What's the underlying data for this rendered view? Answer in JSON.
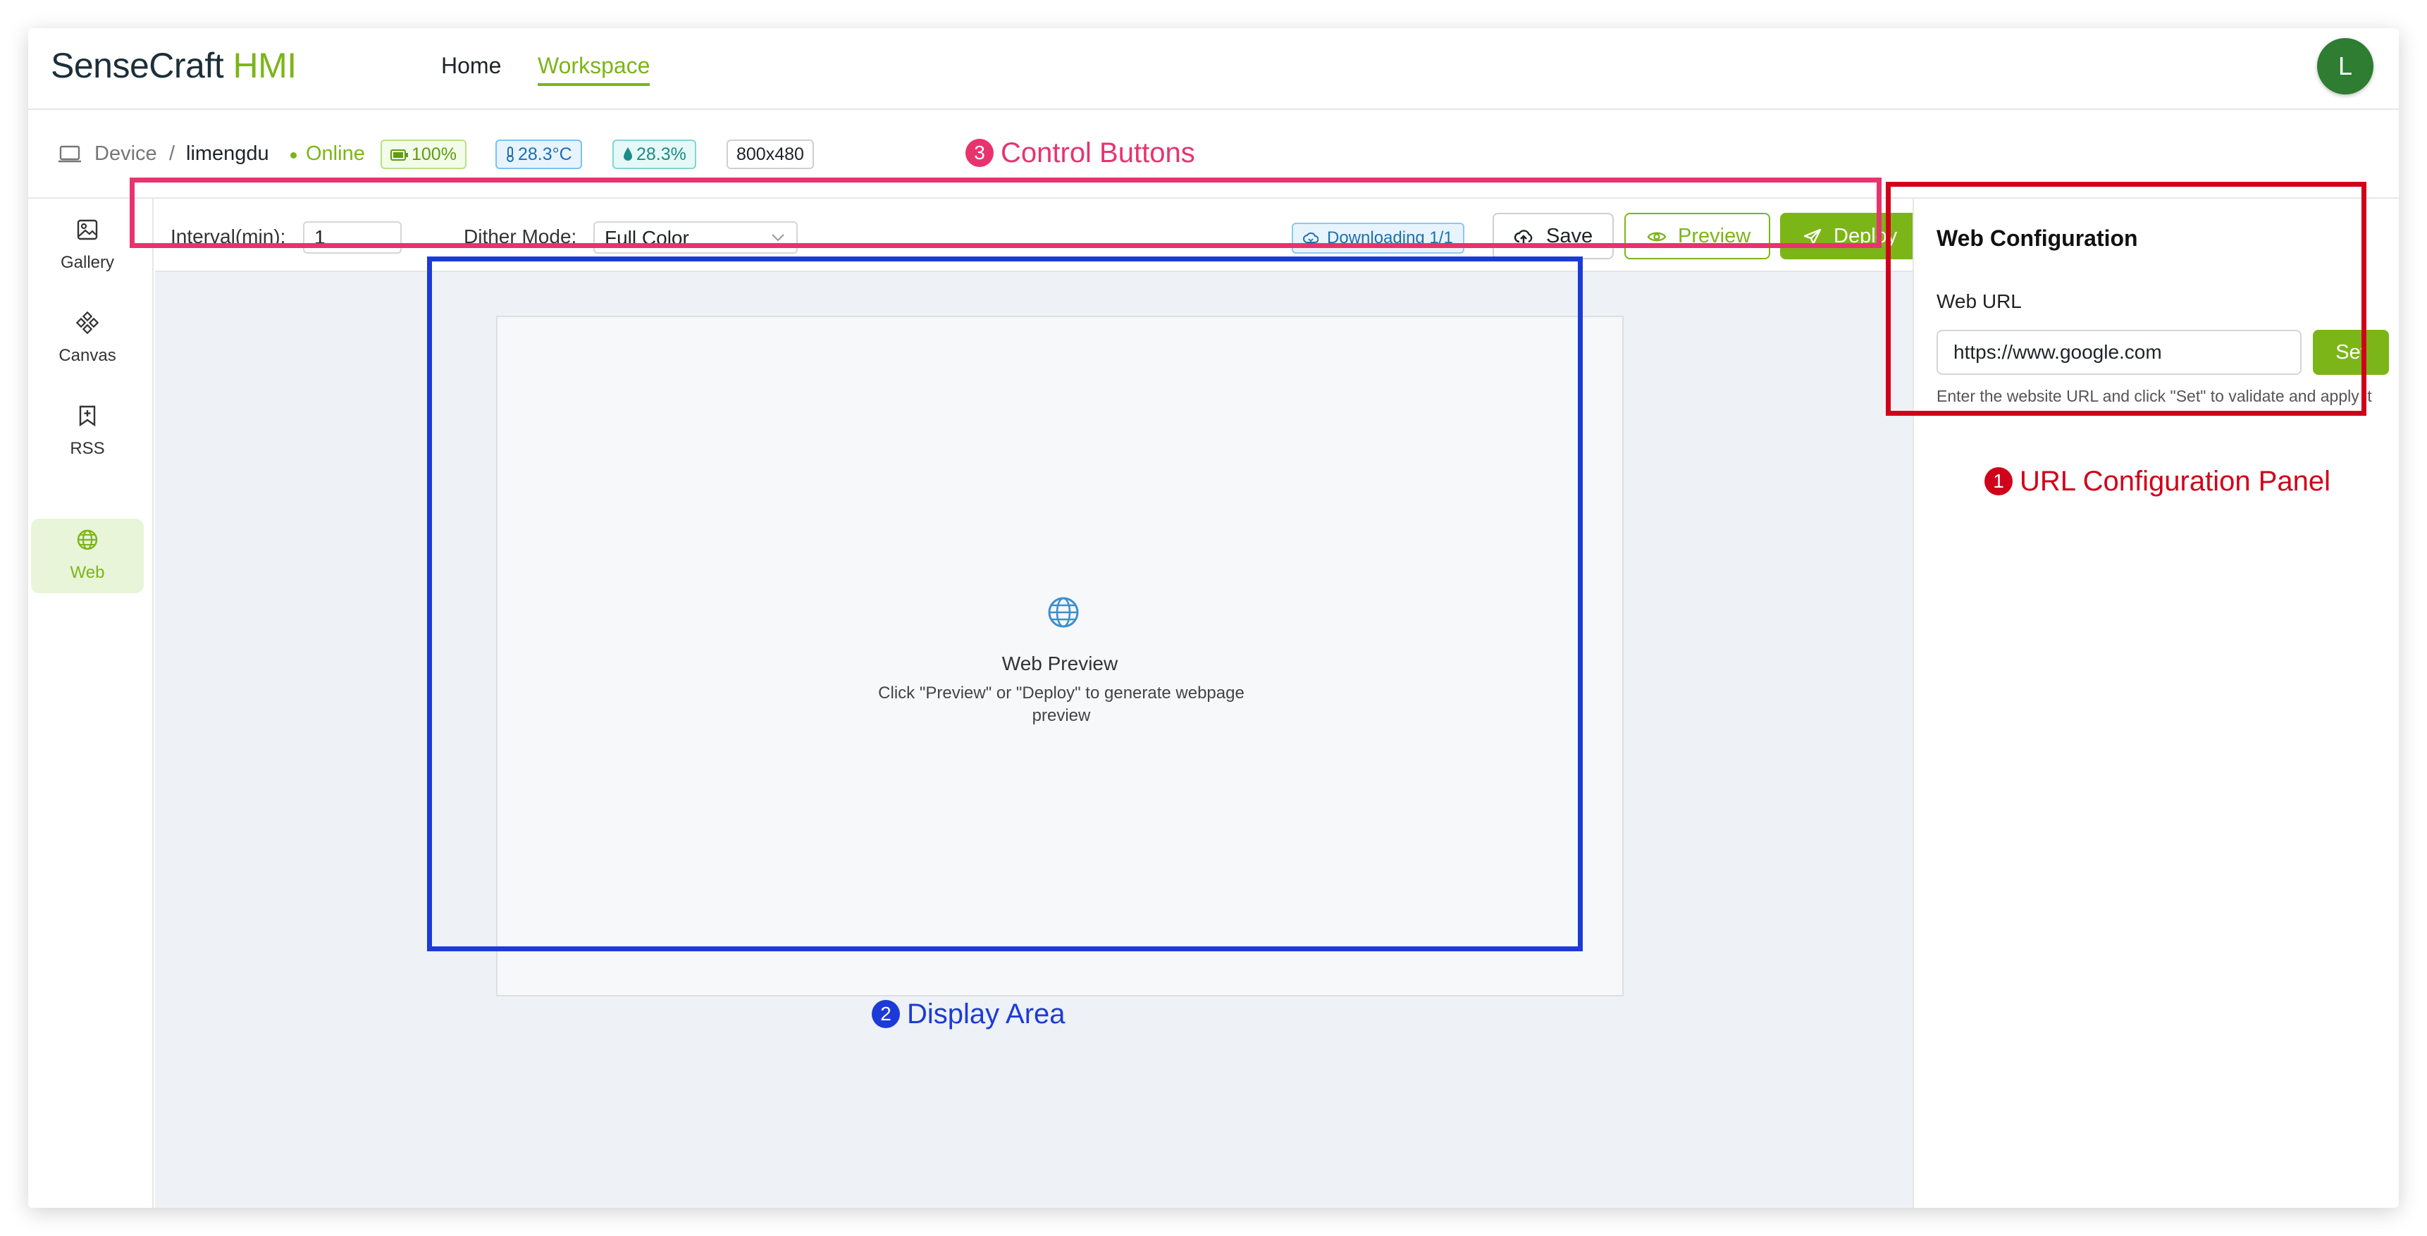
{
  "header": {
    "logo_dark": "SenseCraft",
    "logo_green": "HMI",
    "nav": [
      {
        "label": "Home",
        "active": false
      },
      {
        "label": "Workspace",
        "active": true
      }
    ],
    "avatar_initial": "L"
  },
  "device_bar": {
    "icon": "laptop-icon",
    "label": "Device",
    "separator": "/",
    "name": "limengdu",
    "status": "Online",
    "battery": "100%",
    "temperature": "28.3°C",
    "humidity": "28.3%",
    "resolution": "800x480"
  },
  "sidebar": {
    "items": [
      {
        "label": "Gallery",
        "icon": "image-icon",
        "active": false
      },
      {
        "label": "Canvas",
        "icon": "canvas-icon",
        "active": false
      },
      {
        "label": "RSS",
        "icon": "bookmark-plus-icon",
        "active": false
      },
      {
        "label": "Web",
        "icon": "globe-icon",
        "active": true
      }
    ]
  },
  "toolbar": {
    "interval_label": "Interval(min):",
    "interval_value": "1",
    "dither_label": "Dither Mode:",
    "dither_value": "Full Color",
    "download_status": "Downloading 1/1",
    "save_label": "Save",
    "preview_label": "Preview",
    "deploy_label": "Deploy"
  },
  "display": {
    "icon": "globe-icon",
    "title": "Web Preview",
    "description": "Click \"Preview\" or \"Deploy\" to generate webpage preview"
  },
  "web_config": {
    "title": "Web Configuration",
    "url_label": "Web URL",
    "url_value": "https://www.google.com",
    "set_label": "Set",
    "help_text": "Enter the website URL and click \"Set\" to validate and apply it"
  },
  "annotations": [
    {
      "number": "3",
      "label": "Control Buttons",
      "color": "#e8336e"
    },
    {
      "number": "2",
      "label": "Display Area",
      "color": "#1c3bd6"
    },
    {
      "number": "1",
      "label": "URL Configuration Panel",
      "color": "#d0021b"
    }
  ],
  "colors": {
    "accent_green": "#7cb518",
    "avatar_green": "#2e7d32"
  }
}
